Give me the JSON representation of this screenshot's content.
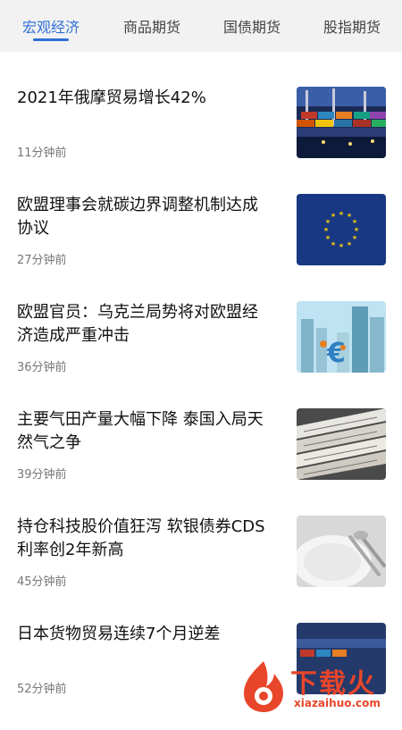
{
  "tabs": [
    {
      "label": "宏观经济",
      "active": true
    },
    {
      "label": "商品期货",
      "active": false
    },
    {
      "label": "国债期货",
      "active": false
    },
    {
      "label": "股指期货",
      "active": false
    }
  ],
  "accent_color": "#2f6fd6",
  "news": [
    {
      "title_lines": [
        "2021年俄摩贸易增长42%"
      ],
      "time": "11分钟前",
      "image": "container-port-photo"
    },
    {
      "title_lines": [
        "欧盟理事会就碳边界调整机制达成",
        "协议"
      ],
      "time": "27分钟前",
      "image": "eu-flag-photo"
    },
    {
      "title_lines": [
        "欧盟官员：乌克兰局势将对欧盟经",
        "济造成严重冲击"
      ],
      "time": "36分钟前",
      "image": "euro-sign-skyscrapers-photo"
    },
    {
      "title_lines": [
        "主要气田产量大幅下降 泰国入局天",
        "然气之争"
      ],
      "time": "39分钟前",
      "image": "newspaper-stack-photo"
    },
    {
      "title_lines": [
        "持仓科技股价值狂泻 软银债券CDS",
        "利率创2年新高"
      ],
      "time": "45分钟前",
      "image": "empty-plate-cutlery-photo"
    },
    {
      "title_lines": [
        "日本货物贸易连续7个月逆差"
      ],
      "time": "52分钟前",
      "image": "harbor-containers-photo"
    }
  ],
  "watermark": {
    "text": "下载火",
    "sub": "xiazaihuo.com"
  }
}
